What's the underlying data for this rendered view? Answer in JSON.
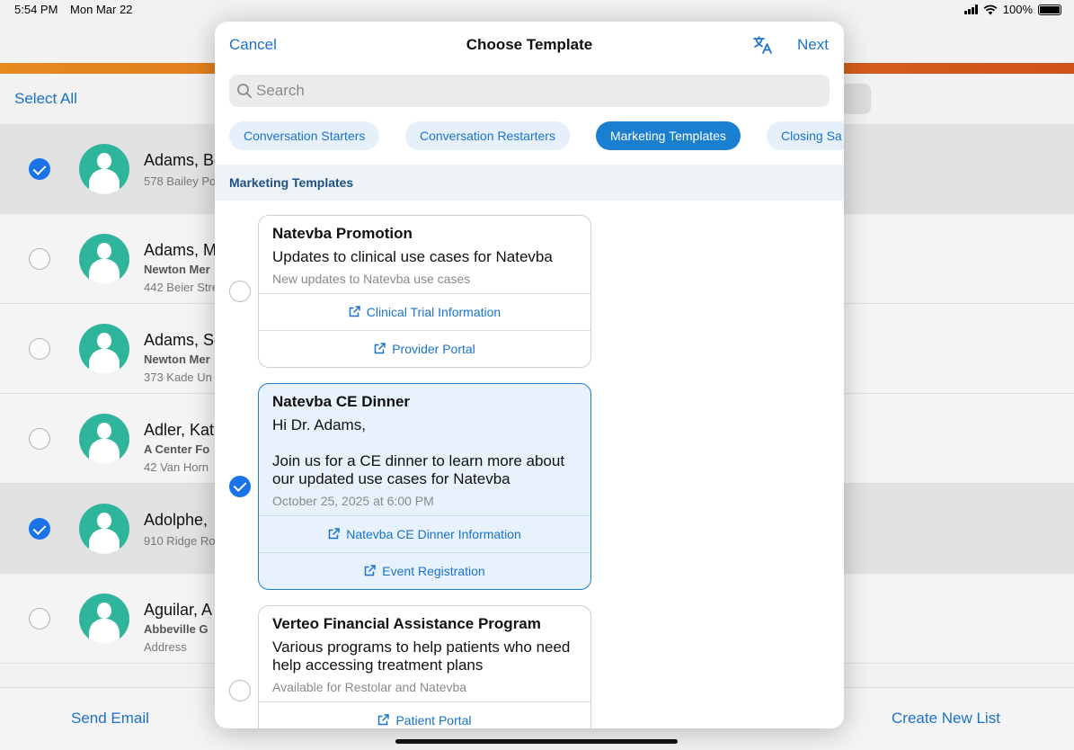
{
  "status_bar": {
    "time": "5:54 PM",
    "date": "Mon Mar 22",
    "battery": "100%"
  },
  "background": {
    "select_all": "Select All",
    "rows": [
      {
        "name": "Adams, Be",
        "sub1": "",
        "sub2": "578 Bailey Po",
        "selected": true
      },
      {
        "name": "Adams, M",
        "sub1": "Newton Mer",
        "sub2": "442 Beier Stre",
        "selected": false
      },
      {
        "name": "Adams, Se",
        "sub1": "Newton Mer",
        "sub2": "373 Kade Un",
        "selected": false
      },
      {
        "name": "Adler, Kat",
        "sub1": "A Center Fo",
        "sub2": "42 Van Horn",
        "selected": false
      },
      {
        "name": "Adolphe, ",
        "sub1": "",
        "sub2": "910 Ridge Ro",
        "selected": true
      },
      {
        "name": "Aguilar, A",
        "sub1": "Abbeville G",
        "sub2": "Address",
        "selected": false
      }
    ],
    "send_email": "Send Email",
    "create_new_list": "Create New List"
  },
  "modal": {
    "cancel": "Cancel",
    "title": "Choose Template",
    "next": "Next",
    "search_placeholder": "Search",
    "chips": [
      {
        "label": "Conversation Starters",
        "active": false
      },
      {
        "label": "Conversation Restarters",
        "active": false
      },
      {
        "label": "Marketing Templates",
        "active": true
      },
      {
        "label": "Closing Sa",
        "active": false
      }
    ],
    "section_title": "Marketing Templates",
    "templates": [
      {
        "title": "Natevba Promotion",
        "body": "Updates to clinical use cases for Natevba",
        "note": "New updates to Natevba use cases",
        "links": [
          "Clinical Trial Information",
          "Provider Portal"
        ],
        "selected": false
      },
      {
        "title": "Natevba CE Dinner",
        "body": "Hi Dr. Adams,\n\nJoin us for a CE dinner to learn more about our updated use cases for Natevba",
        "note": "October 25, 2025 at 6:00 PM",
        "links": [
          "Natevba CE Dinner Information",
          "Event Registration"
        ],
        "selected": true
      },
      {
        "title": "Verteo Financial Assistance Program",
        "body": "Various programs to help patients who need help accessing treatment plans",
        "note": "Available for Restolar and Natevba",
        "links": [
          "Patient Portal"
        ],
        "selected": false
      }
    ]
  },
  "colors": {
    "accent": "#1a73c9",
    "chip_active": "#1a7fd0",
    "avatar": "#2fb59b",
    "brand_bar": "#e58a1f"
  }
}
